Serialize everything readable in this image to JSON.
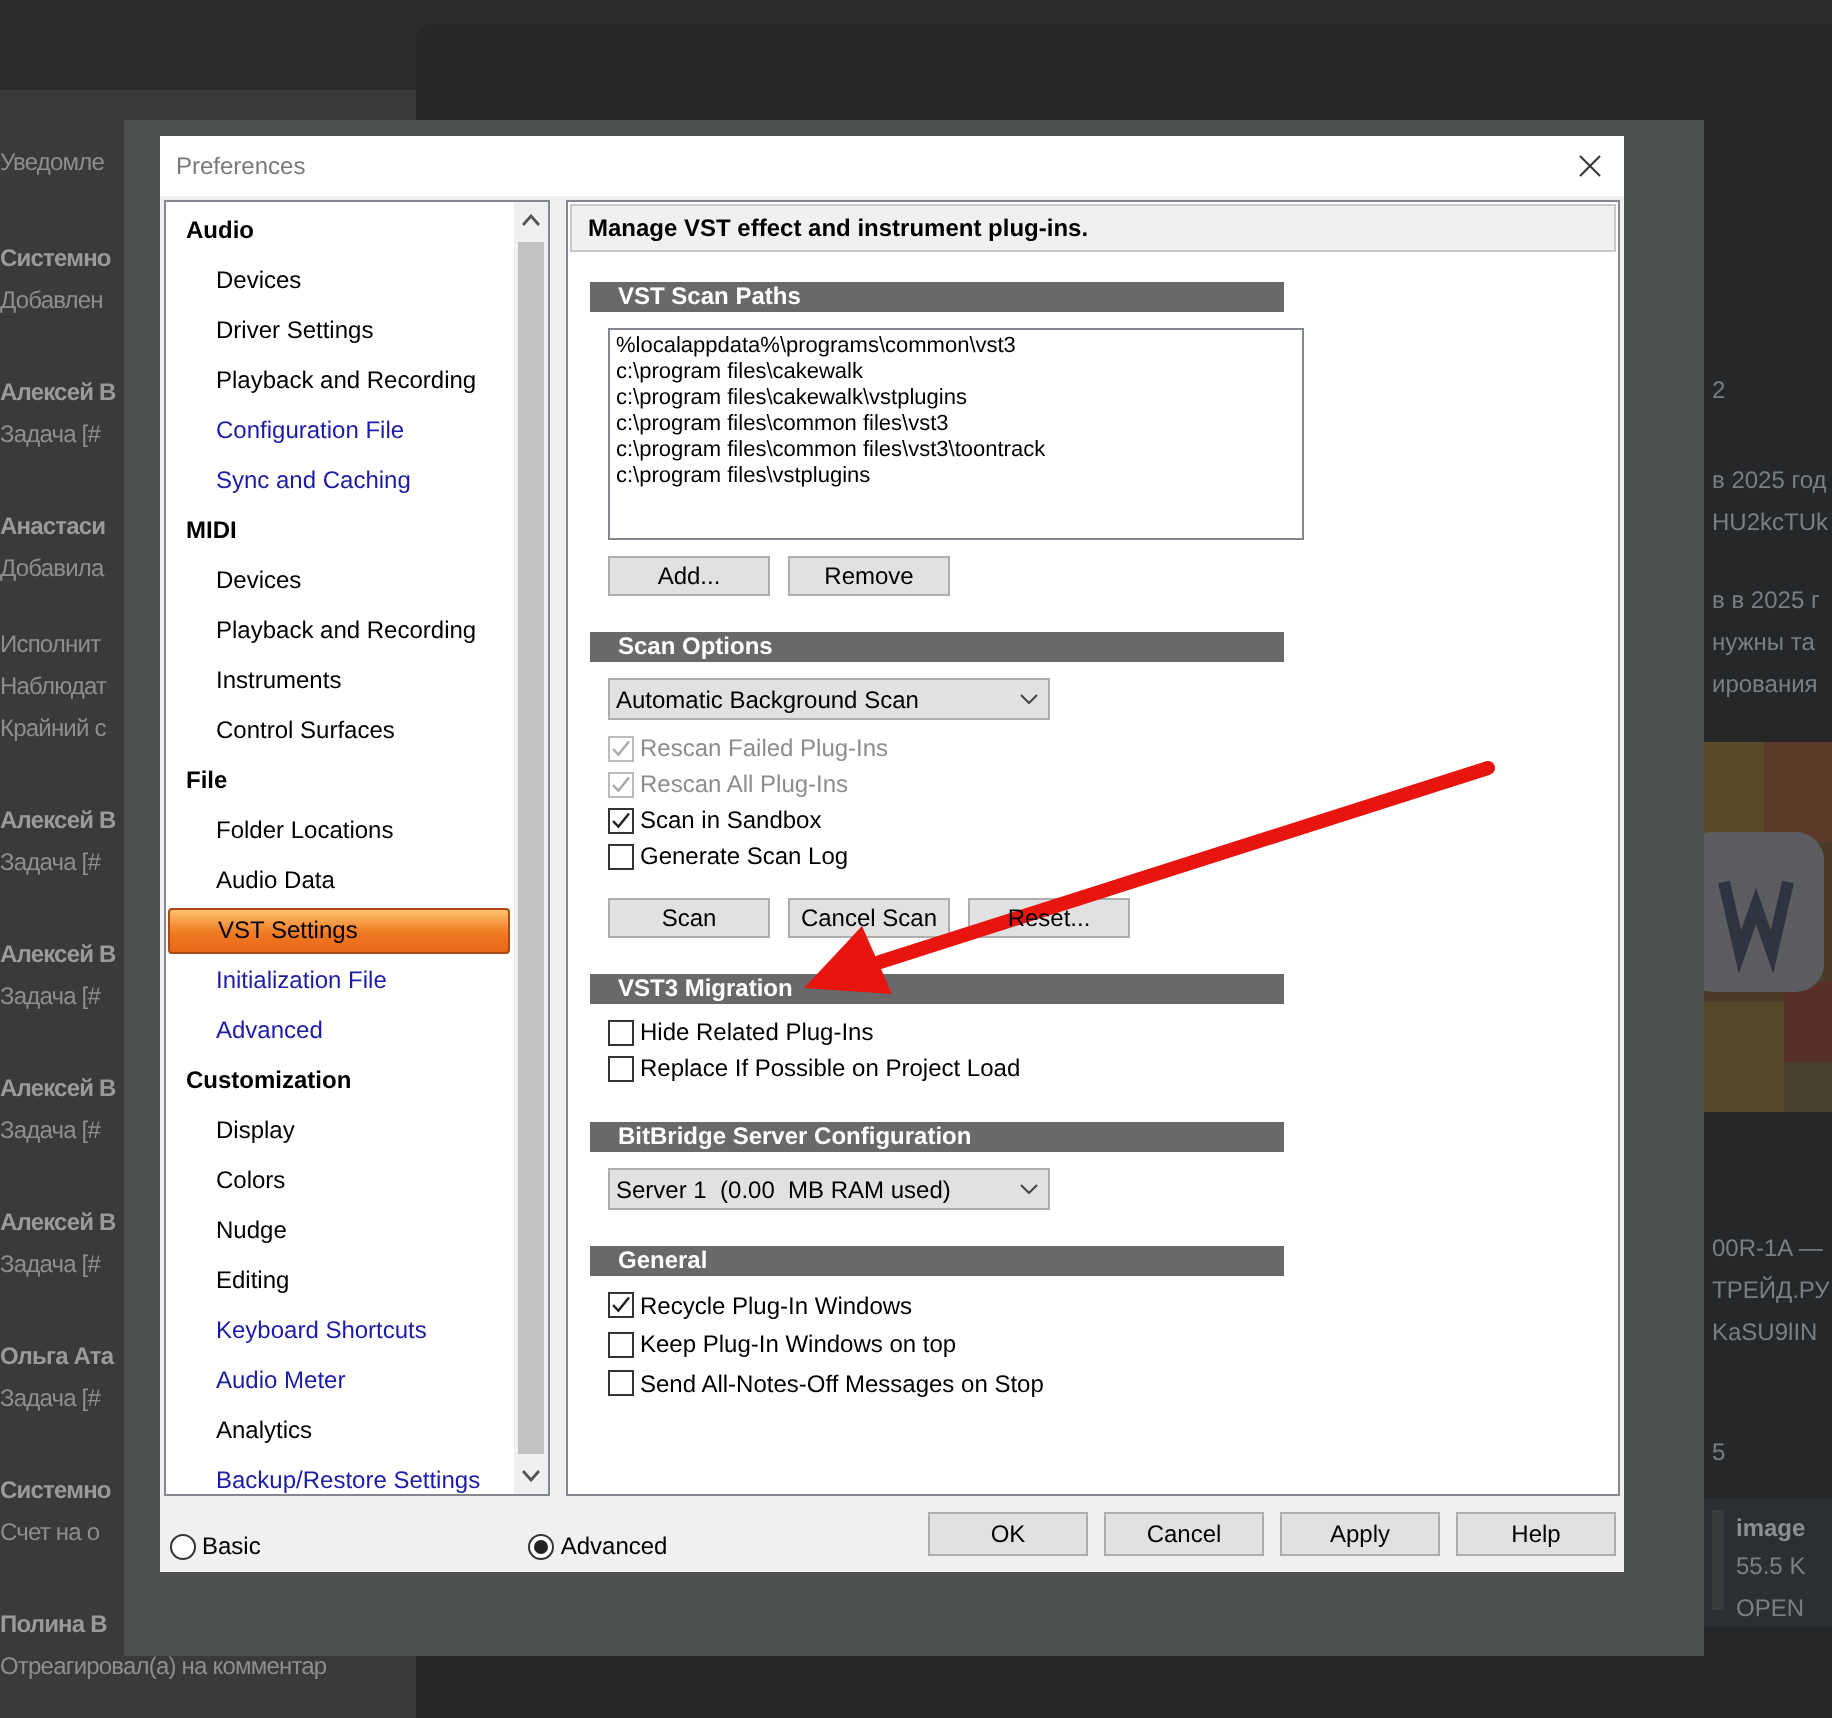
{
  "notifications": {
    "header": "Уведомле",
    "items": [
      {
        "title": "Системно",
        "lines": [
          "Добавлен"
        ]
      },
      {
        "title": "Алексей В",
        "lines": [
          "Задача [#"
        ]
      },
      {
        "title": "Анастаси",
        "lines": [
          "Добавила"
        ]
      },
      {
        "lines": [
          "Исполнит",
          "Наблюдат",
          "Крайний с"
        ]
      },
      {
        "title": "Алексей В",
        "lines": [
          "Задача [#"
        ]
      },
      {
        "title": "Алексей В",
        "lines": [
          "Задача [#"
        ]
      },
      {
        "title": "Алексей В",
        "lines": [
          "Задача [#"
        ]
      },
      {
        "title": "Алексей В",
        "lines": [
          "Задача [#"
        ]
      },
      {
        "title": "Ольга Ата",
        "lines": [
          "Задача [#"
        ]
      },
      {
        "title": "Системно",
        "lines": [
          "Счет на о"
        ]
      },
      {
        "title": "Полина В",
        "lines": [
          "Отреагировал(а) на комментар"
        ]
      }
    ]
  },
  "chat": {
    "blocks": [
      {
        "kind": "date",
        "text": "2"
      },
      {
        "kind": "message",
        "lines": [
          "в 2025 год",
          "HU2kcTUk"
        ]
      },
      {
        "kind": "message",
        "lines": [
          "в в 2025 г",
          "нужны та",
          "ирования"
        ]
      },
      {
        "kind": "picture"
      },
      {
        "kind": "message",
        "lines": [
          "00R-1A —",
          "ТРЕЙД.РУ",
          "KaSU9lIN"
        ]
      },
      {
        "kind": "date",
        "text": "5"
      },
      {
        "kind": "file",
        "name": "image",
        "size": "55.5 K",
        "action": "OPEN"
      }
    ]
  },
  "window": {
    "title": "Preferences"
  },
  "tree": [
    {
      "label": "Audio",
      "children": [
        {
          "label": "Devices",
          "advanced": false,
          "selected": false
        },
        {
          "label": "Driver Settings",
          "advanced": false,
          "selected": false
        },
        {
          "label": "Playback and Recording",
          "advanced": false,
          "selected": false
        },
        {
          "label": "Configuration File",
          "advanced": true,
          "selected": false
        },
        {
          "label": "Sync and Caching",
          "advanced": true,
          "selected": false
        }
      ]
    },
    {
      "label": "MIDI",
      "children": [
        {
          "label": "Devices",
          "advanced": false,
          "selected": false
        },
        {
          "label": "Playback and Recording",
          "advanced": false,
          "selected": false
        },
        {
          "label": "Instruments",
          "advanced": false,
          "selected": false
        },
        {
          "label": "Control Surfaces",
          "advanced": false,
          "selected": false
        }
      ]
    },
    {
      "label": "File",
      "children": [
        {
          "label": "Folder Locations",
          "advanced": false,
          "selected": false
        },
        {
          "label": "Audio Data",
          "advanced": false,
          "selected": false
        },
        {
          "label": "VST Settings",
          "advanced": false,
          "selected": true
        },
        {
          "label": "Initialization File",
          "advanced": true,
          "selected": false
        },
        {
          "label": "Advanced",
          "advanced": true,
          "selected": false
        }
      ]
    },
    {
      "label": "Customization",
      "children": [
        {
          "label": "Display",
          "advanced": false,
          "selected": false
        },
        {
          "label": "Colors",
          "advanced": false,
          "selected": false
        },
        {
          "label": "Nudge",
          "advanced": false,
          "selected": false
        },
        {
          "label": "Editing",
          "advanced": false,
          "selected": false
        },
        {
          "label": "Keyboard Shortcuts",
          "advanced": true,
          "selected": false
        },
        {
          "label": "Audio Meter",
          "advanced": true,
          "selected": false
        },
        {
          "label": "Analytics",
          "advanced": false,
          "selected": false
        },
        {
          "label": "Backup/Restore Settings",
          "advanced": true,
          "selected": false
        }
      ]
    }
  ],
  "mode_options": [
    {
      "label": "Basic",
      "selected": false
    },
    {
      "label": "Advanced",
      "selected": true
    }
  ],
  "buttons": [
    "OK",
    "Cancel",
    "Apply",
    "Help"
  ],
  "panel": {
    "header": "Manage VST effect and instrument plug-ins.",
    "sections": [
      {
        "title": "VST Scan Paths",
        "items": [
          {
            "kind": "list",
            "lines": [
              "%localappdata%\\programs\\common\\vst3",
              "c:\\program files\\cakewalk",
              "c:\\program files\\cakewalk\\vstplugins",
              "c:\\program files\\common files\\vst3",
              "c:\\program files\\common files\\vst3\\toontrack",
              "c:\\program files\\vstplugins"
            ]
          },
          {
            "kind": "buttons",
            "labels": [
              "Add...",
              "Remove"
            ]
          }
        ]
      },
      {
        "title": "Scan Options",
        "items": [
          {
            "kind": "dropdown",
            "value": "Automatic Background Scan"
          },
          {
            "kind": "checkbox",
            "label": "Rescan Failed Plug-Ins",
            "checked": true,
            "disabled": true
          },
          {
            "kind": "checkbox",
            "label": "Rescan All Plug-Ins",
            "checked": true,
            "disabled": true
          },
          {
            "kind": "checkbox",
            "label": "Scan in Sandbox",
            "checked": true,
            "disabled": false
          },
          {
            "kind": "checkbox",
            "label": "Generate Scan Log",
            "checked": false,
            "disabled": false
          },
          {
            "kind": "buttons",
            "labels": [
              "Scan",
              "Cancel Scan",
              "Reset..."
            ]
          }
        ]
      },
      {
        "title": "VST3 Migration",
        "items": [
          {
            "kind": "checkbox",
            "label": "Hide Related Plug-Ins",
            "checked": false,
            "disabled": false
          },
          {
            "kind": "checkbox",
            "label": "Replace If Possible on Project Load",
            "checked": false,
            "disabled": false
          }
        ]
      },
      {
        "title": "BitBridge Server Configuration",
        "items": [
          {
            "kind": "dropdown",
            "value": "Server 1  (0.00  MB RAM used)"
          }
        ]
      },
      {
        "title": "General",
        "items": [
          {
            "kind": "checkbox",
            "label": "Recycle Plug-In Windows",
            "checked": true,
            "disabled": false
          },
          {
            "kind": "checkbox",
            "label": "Keep Plug-In Windows on top",
            "checked": false,
            "disabled": false
          },
          {
            "kind": "checkbox",
            "label": "Send All-Notes-Off Messages on Stop",
            "checked": false,
            "disabled": false
          }
        ]
      }
    ]
  }
}
